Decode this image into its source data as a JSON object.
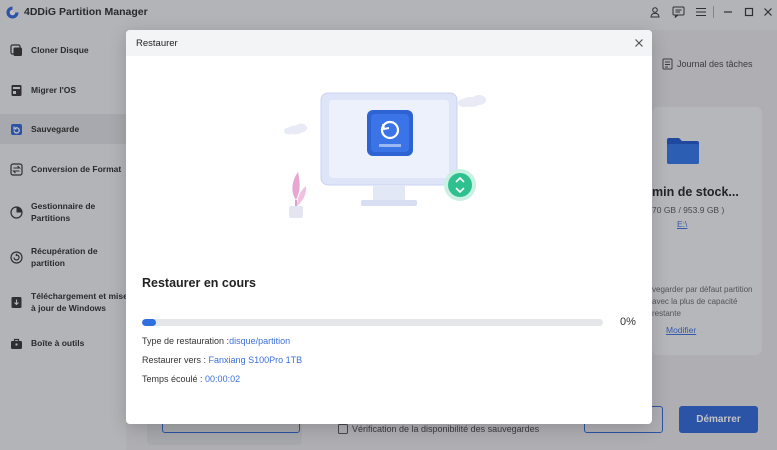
{
  "app": {
    "title": "4DDiG Partition Manager"
  },
  "sidebar": {
    "items": [
      {
        "label": "Cloner Disque",
        "icon": "clone-disk-icon"
      },
      {
        "label": "Migrer l'OS",
        "icon": "migrate-os-icon"
      },
      {
        "label": "Sauvegarde",
        "icon": "backup-icon"
      },
      {
        "label": "Conversion de Format",
        "icon": "convert-icon"
      },
      {
        "label": "Gestionnaire de Partitions",
        "icon": "pie-chart-icon"
      },
      {
        "label": "Récupération de partition",
        "icon": "recovery-icon"
      },
      {
        "label": "Téléchargement et mise à jour de Windows",
        "icon": "windows-download-icon"
      },
      {
        "label": "Boîte à outils",
        "icon": "toolbox-icon"
      }
    ],
    "active_index": 2
  },
  "main": {
    "journal_label": "Journal des tâches",
    "card": {
      "title": "min de stock...",
      "size": "70 GB / 953.9 GB )",
      "drive": "E:\\",
      "description": "vegarder par défaut partition avec la plus de capacité restante",
      "modify_label": "Modifier"
    },
    "verify_label": "Vérification de la disponibilité des sauvegardes",
    "start_label": "Démarrer"
  },
  "modal": {
    "title": "Restaurer",
    "status_title": "Restaurer en cours",
    "progress_fraction": 0.02,
    "percent_text": "0%",
    "restore_type_label": "Type de restauration :",
    "restore_type_value": "disque/partition",
    "restore_to_label": "Restaurer vers :",
    "restore_to_value": "Fanxiang S100Pro 1TB",
    "elapsed_label": "Temps écoulé :",
    "elapsed_value": "00:00:02"
  },
  "colors": {
    "accent": "#2f66d4",
    "link": "#3a6fd8",
    "teal": "#2ec08f"
  }
}
